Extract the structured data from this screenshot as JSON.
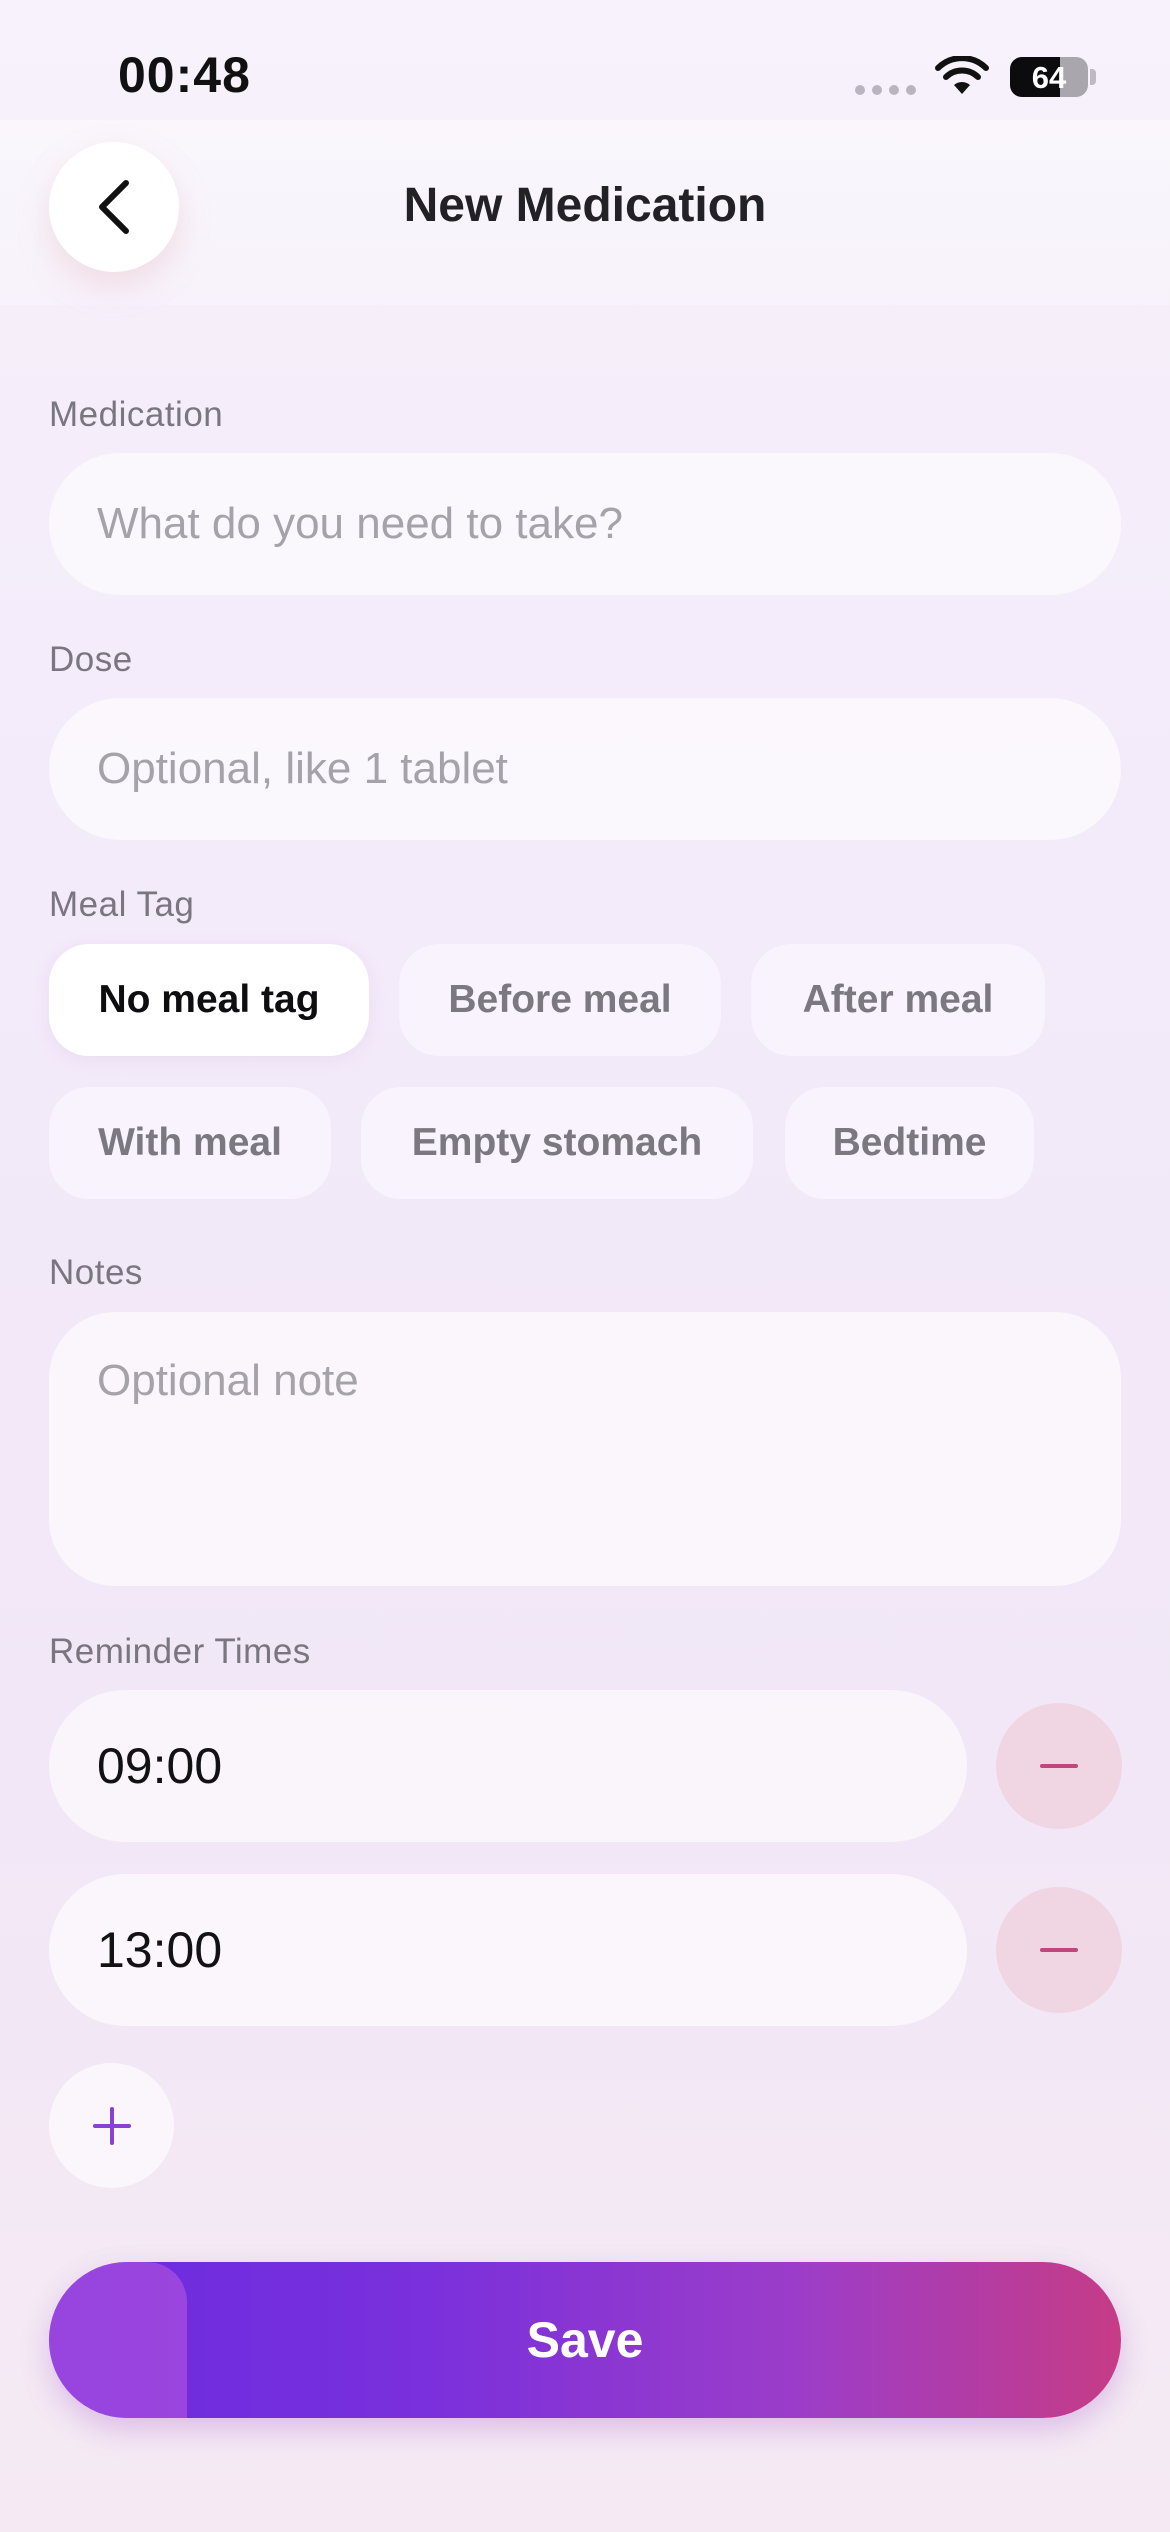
{
  "status_bar": {
    "time": "00:48",
    "battery": "64"
  },
  "header": {
    "title": "New Medication"
  },
  "form": {
    "medication": {
      "label": "Medication",
      "value": "",
      "placeholder": "What do you need to take?"
    },
    "dose": {
      "label": "Dose",
      "value": "",
      "placeholder": "Optional, like 1 tablet"
    },
    "meal_tag": {
      "label": "Meal Tag",
      "selected": "No meal tag",
      "options": [
        "No meal tag",
        "Before meal",
        "After meal",
        "With meal",
        "Empty stomach",
        "Bedtime"
      ]
    },
    "notes": {
      "label": "Notes",
      "value": "",
      "placeholder": "Optional note"
    },
    "reminders": {
      "label": "Reminder Times",
      "times": [
        "09:00",
        "13:00"
      ]
    }
  },
  "actions": {
    "save_label": "Save"
  },
  "colors": {
    "accent_start": "#6a2be0",
    "accent_end": "#c63c86",
    "remove_bg": "#efd6e2",
    "remove_icon": "#c2467e",
    "add_icon": "#8a3fd6"
  }
}
